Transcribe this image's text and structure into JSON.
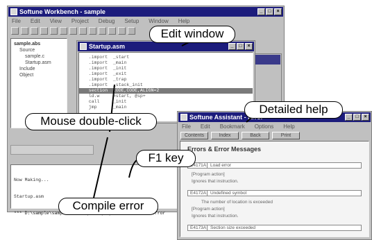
{
  "main_window": {
    "title": "Softune Workbench - sample",
    "menu": [
      "File",
      "Edit",
      "View",
      "Project",
      "Debug",
      "Setup",
      "Window",
      "Help"
    ],
    "tree": [
      "sample.abs",
      "Source",
      "sample.c",
      "Startup.asm",
      "Include",
      "Object"
    ]
  },
  "edit_window": {
    "title": "Startup.asm",
    "code_lines": [
      "  .import  _start",
      "  .import  _main",
      "  .import  _init",
      "  .import  _exit",
      "  .import  _trap",
      "  .import  _stack_init",
      "  section  CODE,CODE,ALIGN=2",
      "  ld.w     #start, @sp+",
      "  call     _init",
      "  jmp      _main"
    ],
    "highlight_index": 6
  },
  "output_panel": {
    "lines": [
      "Now Making...",
      "Startup.asm",
      "*** D:\\sample\\sample\\Startup.asm(25)  E4171A  Load error"
    ]
  },
  "help_window": {
    "title": "Softune Assistant - Error",
    "menu": [
      "File",
      "Edit",
      "Bookmark",
      "Options",
      "Help"
    ],
    "buttons": [
      "Contents",
      "Index",
      "Back",
      "Print"
    ],
    "heading": "Errors & Error Messages",
    "rows": [
      {
        "code": "E4171A",
        "text": "Load error"
      },
      {
        "code": "E4172A",
        "text": "Undefined symbol"
      },
      {
        "code": "E4173A",
        "text": "Section size exceeded"
      }
    ],
    "texts": [
      "[Program action]",
      "Ignores that instruction.",
      "The number of location is exceeded",
      "[Program action]",
      "Ignores that instruction."
    ]
  },
  "callouts": {
    "edit_window": "Edit window",
    "detailed_help": "Detailed help",
    "mouse_double_click": "Mouse double-click",
    "f1_key": "F1 key",
    "compile_error": "Compile error"
  }
}
